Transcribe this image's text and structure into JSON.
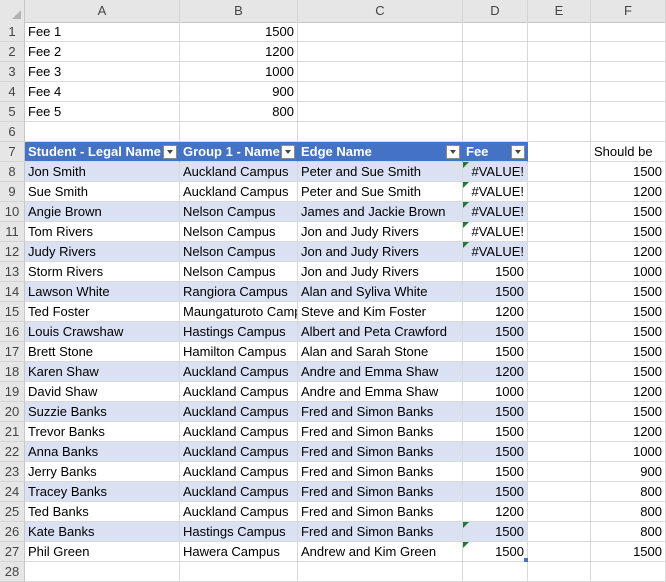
{
  "columns": [
    "A",
    "B",
    "C",
    "D",
    "E",
    "F"
  ],
  "fees": [
    {
      "row": "1",
      "label": "Fee 1",
      "value": "1500"
    },
    {
      "row": "2",
      "label": "Fee 2",
      "value": "1200"
    },
    {
      "row": "3",
      "label": "Fee 3",
      "value": "1000"
    },
    {
      "row": "4",
      "label": "Fee 4",
      "value": "900"
    },
    {
      "row": "5",
      "label": "Fee 5",
      "value": "800"
    }
  ],
  "blank_rows": [
    "6",
    "28"
  ],
  "table": {
    "header_row": "7",
    "headers": [
      "Student - Legal Name",
      "Group 1 - Name",
      "Edge Name",
      "Fee"
    ],
    "should_be_label": "Should be",
    "rows": [
      {
        "row": "8",
        "student": "Jon Smith",
        "group": "Auckland Campus",
        "edge": "Peter and Sue Smith",
        "fee": "#VALUE!",
        "should": "1500",
        "flag": true
      },
      {
        "row": "9",
        "student": "Sue Smith",
        "group": "Auckland Campus",
        "edge": "Peter and Sue Smith",
        "fee": "#VALUE!",
        "should": "1200",
        "flag": true
      },
      {
        "row": "10",
        "student": "Angie Brown",
        "group": "Nelson Campus",
        "edge": "James and Jackie Brown",
        "fee": "#VALUE!",
        "should": "1500",
        "flag": true
      },
      {
        "row": "11",
        "student": "Tom Rivers",
        "group": "Nelson Campus",
        "edge": "Jon and Judy Rivers",
        "fee": "#VALUE!",
        "should": "1500",
        "flag": true
      },
      {
        "row": "12",
        "student": "Judy Rivers",
        "group": "Nelson Campus",
        "edge": "Jon and Judy Rivers",
        "fee": "#VALUE!",
        "should": "1200",
        "flag": true
      },
      {
        "row": "13",
        "student": "Storm Rivers",
        "group": "Nelson Campus",
        "edge": "Jon and Judy Rivers",
        "fee": "1500",
        "should": "1000",
        "flag": false
      },
      {
        "row": "14",
        "student": "Lawson White",
        "group": "Rangiora Campus",
        "edge": "Alan and Syliva White",
        "fee": "1500",
        "should": "1500",
        "flag": false
      },
      {
        "row": "15",
        "student": "Ted Foster",
        "group": "Maungaturoto Campus",
        "edge": "Steve and Kim Foster",
        "fee": "1200",
        "should": "1500",
        "flag": false
      },
      {
        "row": "16",
        "student": "Louis Crawshaw",
        "group": "Hastings Campus",
        "edge": "Albert and Peta Crawford",
        "fee": "1500",
        "should": "1500",
        "flag": false
      },
      {
        "row": "17",
        "student": "Brett Stone",
        "group": "Hamilton Campus",
        "edge": "Alan and Sarah Stone",
        "fee": "1500",
        "should": "1500",
        "flag": false
      },
      {
        "row": "18",
        "student": "Karen Shaw",
        "group": "Auckland Campus",
        "edge": "Andre and Emma Shaw",
        "fee": "1200",
        "should": "1500",
        "flag": false
      },
      {
        "row": "19",
        "student": "David Shaw",
        "group": "Auckland Campus",
        "edge": "Andre and Emma Shaw",
        "fee": "1000",
        "should": "1200",
        "flag": false
      },
      {
        "row": "20",
        "student": "Suzzie Banks",
        "group": "Auckland Campus",
        "edge": "Fred and Simon Banks",
        "fee": "1500",
        "should": "1500",
        "flag": false
      },
      {
        "row": "21",
        "student": "Trevor Banks",
        "group": "Auckland Campus",
        "edge": "Fred and Simon Banks",
        "fee": "1500",
        "should": "1200",
        "flag": false
      },
      {
        "row": "22",
        "student": "Anna Banks",
        "group": "Auckland Campus",
        "edge": "Fred and Simon Banks",
        "fee": "1500",
        "should": "1000",
        "flag": false
      },
      {
        "row": "23",
        "student": "Jerry Banks",
        "group": "Auckland Campus",
        "edge": "Fred and Simon Banks",
        "fee": "1500",
        "should": "900",
        "flag": false
      },
      {
        "row": "24",
        "student": "Tracey Banks",
        "group": "Auckland Campus",
        "edge": "Fred and Simon Banks",
        "fee": "1500",
        "should": "800",
        "flag": false
      },
      {
        "row": "25",
        "student": "Ted Banks",
        "group": "Auckland Campus",
        "edge": "Fred and Simon Banks",
        "fee": "1200",
        "should": "800",
        "flag": false
      },
      {
        "row": "26",
        "student": "Kate Banks",
        "group": "Hastings Campus",
        "edge": "Fred and Simon Banks",
        "fee": "1500",
        "should": "800",
        "flag": true
      },
      {
        "row": "27",
        "student": "Phil Green",
        "group": "Hawera Campus",
        "edge": "Andrew and Kim  Green",
        "fee": "1500",
        "should": "1500",
        "flag": true
      }
    ]
  },
  "colors": {
    "table_header": "#4472c4",
    "band": "#d9e1f2",
    "error_flag": "#1e7b34"
  }
}
